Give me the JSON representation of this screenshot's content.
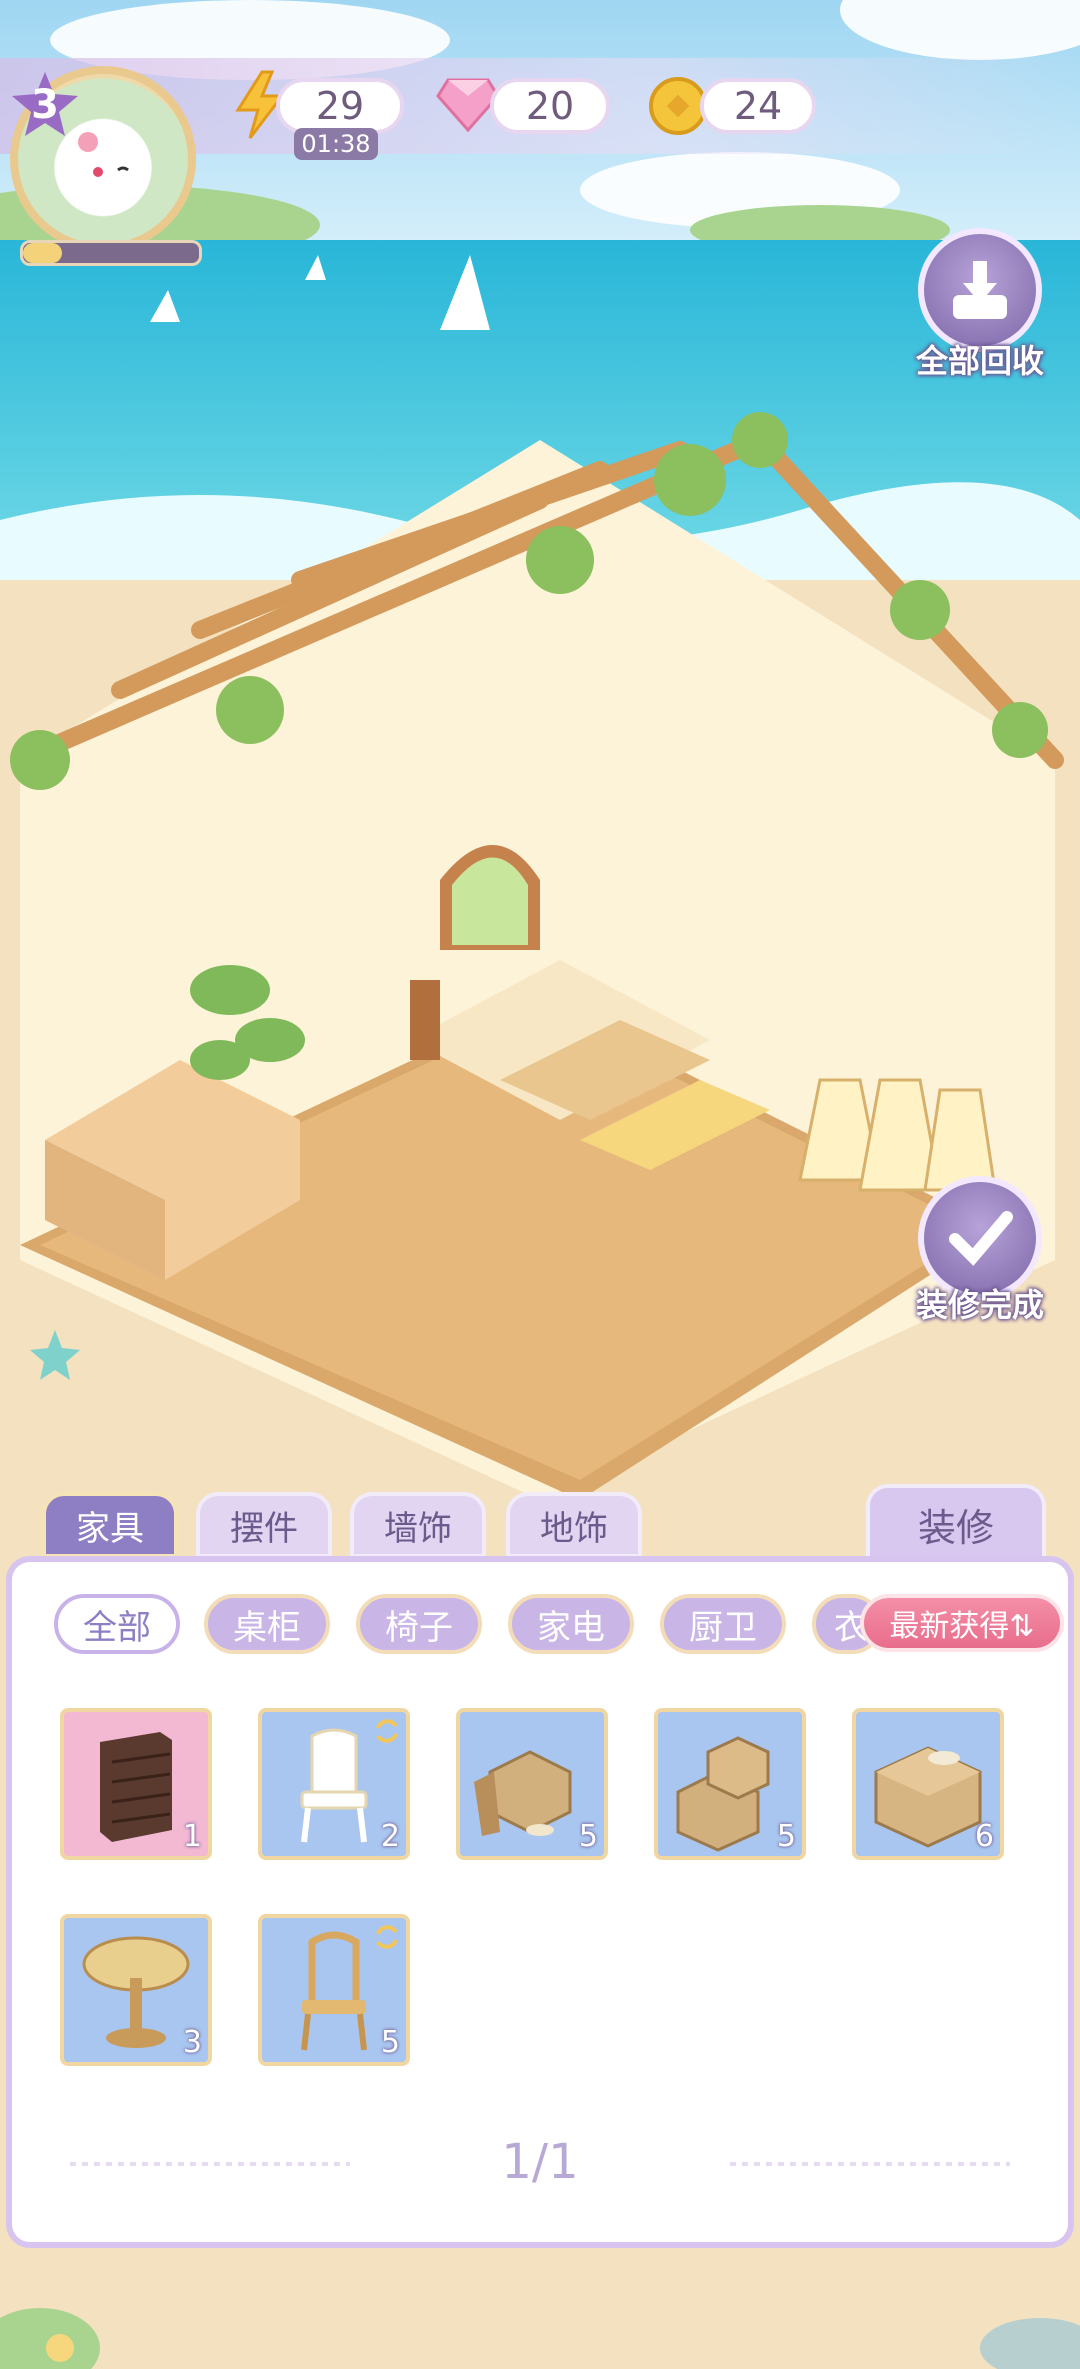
{
  "player": {
    "level": "3",
    "xp_fraction": 0.22
  },
  "resources": {
    "energy": {
      "value": "29",
      "timer": "01:38",
      "icon": "lightning-icon"
    },
    "gems": {
      "value": "20",
      "icon": "pink-gem-icon"
    },
    "coins": {
      "value": "24",
      "icon": "gold-coin-icon"
    }
  },
  "actions": {
    "recall_all": "全部回收",
    "finish_decor": "装修完成"
  },
  "category_tabs": [
    "家具",
    "摆件",
    "墙饰",
    "地饰"
  ],
  "renovate_label": "装修",
  "sub_tabs": [
    "全部",
    "桌柜",
    "椅子",
    "家电",
    "厨卫",
    "衣"
  ],
  "sort_label": "最新获得⇅",
  "items": [
    {
      "name": "dresser",
      "count": "1"
    },
    {
      "name": "white-chair",
      "count": "2"
    },
    {
      "name": "box-pile",
      "count": "5"
    },
    {
      "name": "box-stack",
      "count": "5"
    },
    {
      "name": "cardboard-box",
      "count": "6"
    },
    {
      "name": "round-table",
      "count": "3"
    },
    {
      "name": "wooden-chair",
      "count": "5"
    }
  ],
  "pagination": "1/1",
  "colors": {
    "accent": "#8e7ec4",
    "panel_border": "#d8c5ef",
    "sort_pink": "#e86d8c"
  }
}
